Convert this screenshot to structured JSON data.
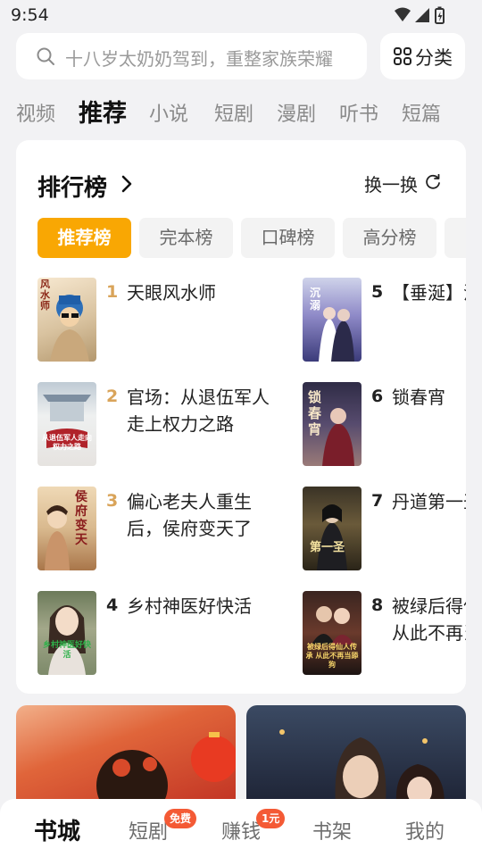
{
  "status_bar": {
    "time": "9:54"
  },
  "search": {
    "placeholder": "十八岁太奶奶驾到，重整家族荣耀"
  },
  "category_button": {
    "label": "分类"
  },
  "channel_tabs": [
    {
      "label": "视频"
    },
    {
      "label": "推荐",
      "active": true
    },
    {
      "label": "小说"
    },
    {
      "label": "短剧"
    },
    {
      "label": "漫剧"
    },
    {
      "label": "听书"
    },
    {
      "label": "短篇"
    }
  ],
  "ranking": {
    "title": "排行榜",
    "refresh_label": "换一换",
    "tabs": [
      {
        "label": "推荐榜",
        "active": true
      },
      {
        "label": "完本榜"
      },
      {
        "label": "口碑榜"
      },
      {
        "label": "高分榜"
      }
    ],
    "books": [
      {
        "rank": "1",
        "title": "天眼风水师"
      },
      {
        "rank": "2",
        "title": "官场：从退伍军人走上权力之路"
      },
      {
        "rank": "3",
        "title": "偏心老夫人重生后，侯府变天了"
      },
      {
        "rank": "4",
        "title": "乡村神医好快活"
      },
      {
        "rank": "5",
        "title": "【垂涎】沉溺"
      },
      {
        "rank": "6",
        "title": "锁春宵"
      },
      {
        "rank": "7",
        "title": "丹道第一圣"
      },
      {
        "rank": "8",
        "title": "被绿后得仙人传承 从此不再当舔狗"
      }
    ],
    "cover_texts": {
      "book1": "风水师",
      "book2": "从退伍军人走向权力之路",
      "book3": "侯府变天",
      "book4": "乡村神医好快活",
      "book5": "沉溺",
      "book6": "锁春宵",
      "book7": "第一圣",
      "book8": "被绿后得仙人传承 从此不再当舔狗"
    }
  },
  "bottom_nav": [
    {
      "label": "书城",
      "active": true
    },
    {
      "label": "短剧",
      "badge": "免费"
    },
    {
      "label": "赚钱",
      "badge": "1元"
    },
    {
      "label": "书架"
    },
    {
      "label": "我的"
    }
  ],
  "colors": {
    "accent": "#f9a703",
    "rank_top": "#d9a45a",
    "rank_other": "#222222",
    "badge": "#f45a35",
    "background": "#f2f2f4"
  },
  "icons": {
    "search": "search-icon",
    "category": "grid-icon",
    "chevron": "chevron-right-icon",
    "refresh": "refresh-icon",
    "wifi": "wifi-icon",
    "signal": "signal-icon",
    "battery": "battery-icon"
  }
}
